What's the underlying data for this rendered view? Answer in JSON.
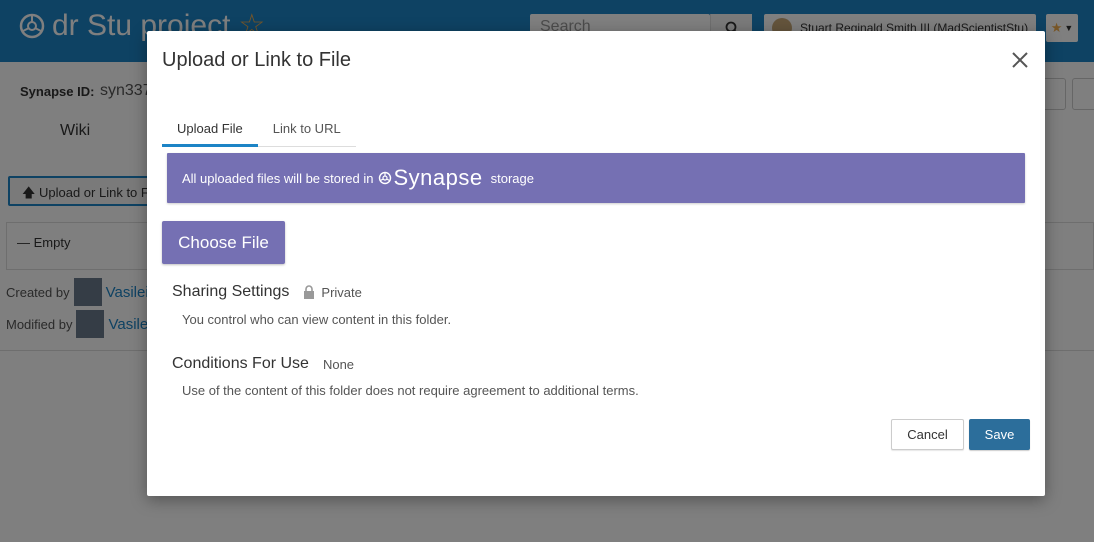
{
  "background": {
    "project_title": "dr Stu project",
    "search_placeholder": "Search",
    "user_name": "Stuart Reginald Smith III (MadScientistStu)",
    "synapse_id_label": "Synapse ID:",
    "synapse_id_value": "syn337",
    "tab_wiki": "Wiki",
    "upload_button_label": "Upload or Link to F",
    "empty_label": "— Empty",
    "created_by_label": "Created by",
    "created_by_user": "Vasilei",
    "modified_by_label": "Modified by",
    "modified_by_user": "Vasile"
  },
  "modal": {
    "title": "Upload or Link to File",
    "tabs": [
      {
        "label": "Upload File",
        "active": true
      },
      {
        "label": "Link to URL",
        "active": false
      }
    ],
    "banner": {
      "text_before": "All uploaded files will be stored in",
      "brand": "Synapse",
      "text_after": "storage"
    },
    "choose_file_label": "Choose File",
    "sharing": {
      "title": "Sharing Settings",
      "value": "Private",
      "description": "You control who can view content in this folder."
    },
    "conditions": {
      "title": "Conditions For Use",
      "value": "None",
      "description": "Use of the content of this folder does not require agreement to additional terms."
    },
    "cancel_label": "Cancel",
    "save_label": "Save"
  },
  "colors": {
    "header_blue": "#1c84c6",
    "banner_purple": "#7570b3",
    "save_blue": "#2c6e9b",
    "star_gold": "#f0ad4e"
  }
}
